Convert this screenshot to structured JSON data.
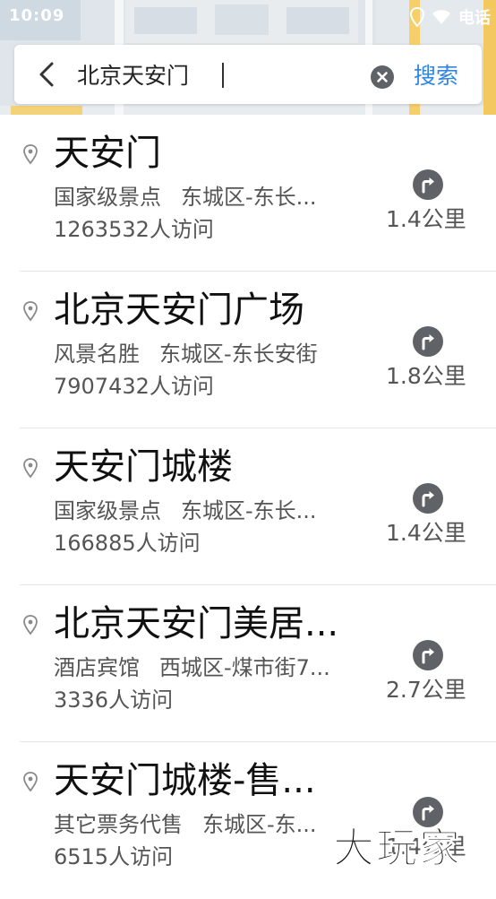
{
  "status_bar": {
    "time": "10:09",
    "right_text": "电话"
  },
  "search": {
    "query": "北京天安门",
    "search_label": "搜索"
  },
  "results": [
    {
      "title": "天安门",
      "category": "国家级景点",
      "address": "东城区-东长...",
      "visits": "1263532人访问",
      "distance": "1.4公里"
    },
    {
      "title": "北京天安门广场",
      "category": "风景名胜",
      "address": "东城区-东长安街",
      "visits": "7907432人访问",
      "distance": "1.8公里"
    },
    {
      "title": "天安门城楼",
      "category": "国家级景点",
      "address": "东城区-东长...",
      "visits": "166885人访问",
      "distance": "1.4公里"
    },
    {
      "title": "北京天安门美居...",
      "category": "酒店宾馆",
      "address": "西城区-煤市街7...",
      "visits": "3336人访问",
      "distance": "2.7公里"
    },
    {
      "title": "天安门城楼-售...",
      "category": "其它票务代售",
      "address": "东城区-东...",
      "visits": "6515人访问",
      "distance": "1.4公里"
    }
  ],
  "watermark": "大玩家",
  "colors": {
    "accent": "#2f86e4",
    "icon_gray": "#5f6368",
    "text_primary": "#111111",
    "text_secondary": "#555555"
  },
  "icons": {
    "back": "chevron-left-icon",
    "clear": "clear-icon",
    "pin": "location-pin-icon",
    "nav": "navigation-arrow-icon"
  }
}
